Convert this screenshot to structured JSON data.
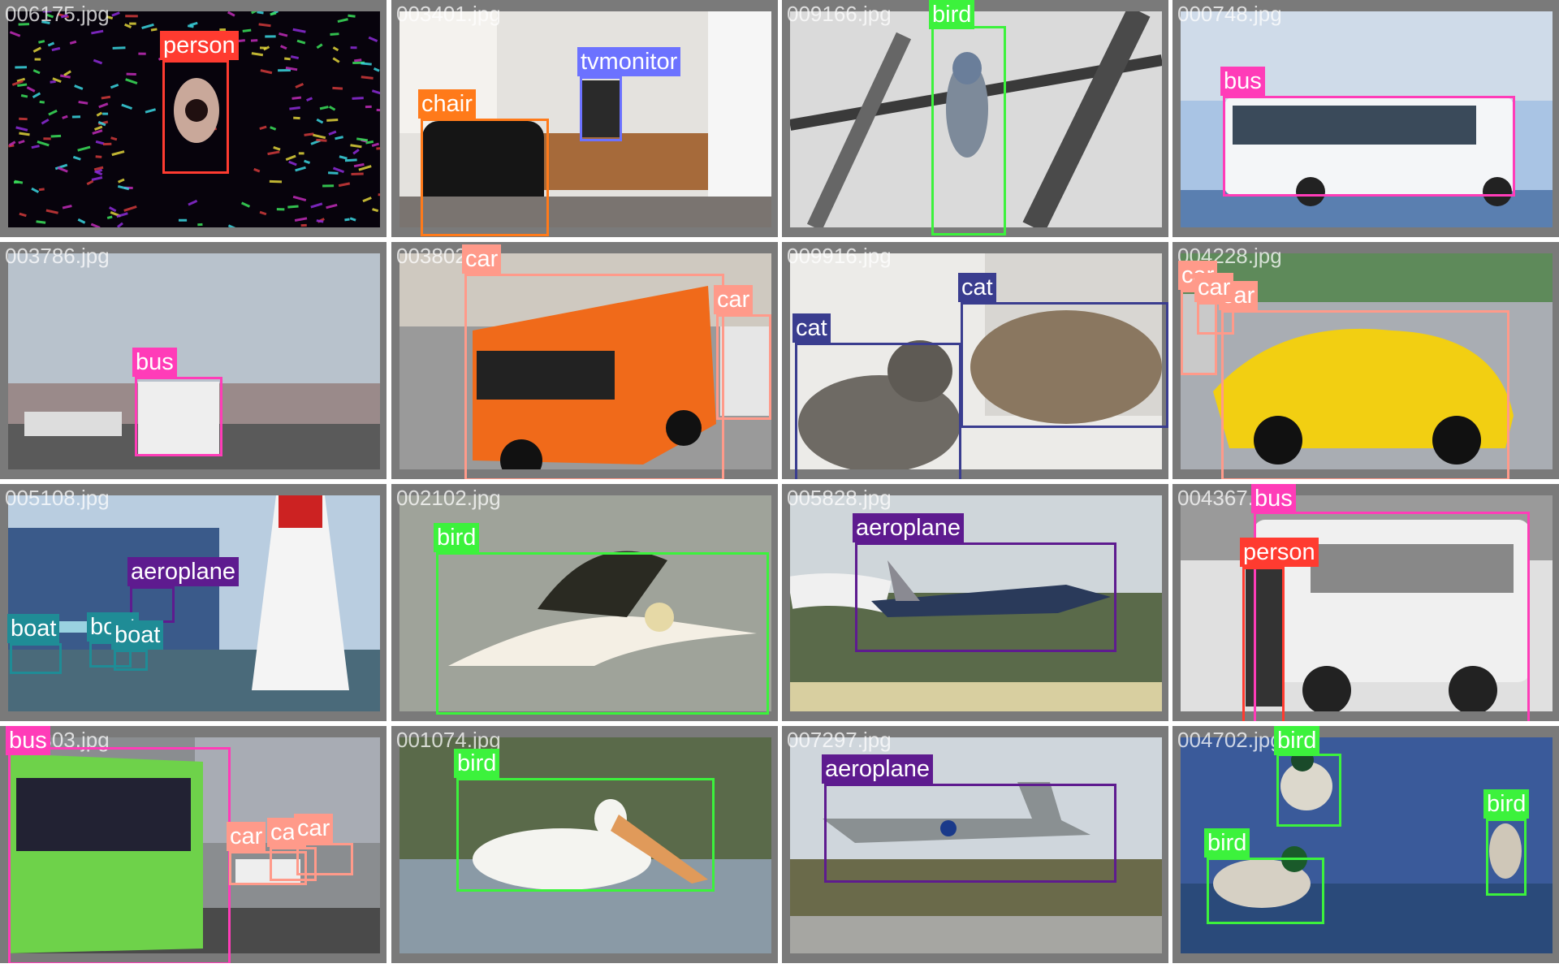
{
  "class_colors": {
    "person": "#ff3b30",
    "chair": "#ff7a1a",
    "tvmonitor": "#6c72ff",
    "bird": "#3cf23c",
    "bus": "#ff3cb8",
    "car": "#ff9a8a",
    "cat": "#3a3d8f",
    "aeroplane": "#5e1b8f",
    "boat": "#1f8c96"
  },
  "tiles": [
    {
      "file": "006175.jpg",
      "scene": "dark-sparkles",
      "labels": [
        {
          "text": "person",
          "cls": "person"
        }
      ]
    },
    {
      "file": "003401.jpg",
      "scene": "office-room",
      "labels": [
        {
          "text": "tvmonitor",
          "cls": "tvmonitor"
        },
        {
          "text": "chair",
          "cls": "chair"
        }
      ]
    },
    {
      "file": "009166.jpg",
      "scene": "bird-branch",
      "labels": [
        {
          "text": "bird",
          "cls": "bird"
        }
      ]
    },
    {
      "file": "000748.jpg",
      "scene": "white-bus",
      "labels": [
        {
          "text": "bus",
          "cls": "bus"
        }
      ]
    },
    {
      "file": "003786.jpg",
      "scene": "cloudy-road",
      "labels": [
        {
          "text": "bus",
          "cls": "bus"
        }
      ]
    },
    {
      "file": "003802.jpg",
      "scene": "orange-van",
      "labels": [
        {
          "text": "car",
          "cls": "car"
        },
        {
          "text": "car",
          "cls": "car"
        }
      ]
    },
    {
      "file": "009916.jpg",
      "scene": "two-cats",
      "labels": [
        {
          "text": "cat",
          "cls": "cat"
        },
        {
          "text": "cat",
          "cls": "cat"
        }
      ]
    },
    {
      "file": "004228.jpg",
      "scene": "yellow-car",
      "labels": [
        {
          "text": "car",
          "cls": "car"
        },
        {
          "text": "car",
          "cls": "car"
        },
        {
          "text": "car",
          "cls": "car"
        }
      ]
    },
    {
      "file": "005108.jpg",
      "scene": "harbor-plane",
      "labels": [
        {
          "text": "aeroplane",
          "cls": "aeroplane"
        },
        {
          "text": "boat",
          "cls": "boat"
        },
        {
          "text": "boat",
          "cls": "boat"
        },
        {
          "text": "boat",
          "cls": "boat"
        }
      ]
    },
    {
      "file": "002102.jpg",
      "scene": "gannet",
      "labels": [
        {
          "text": "bird",
          "cls": "bird"
        }
      ]
    },
    {
      "file": "005828.jpg",
      "scene": "jet-smoke",
      "labels": [
        {
          "text": "aeroplane",
          "cls": "aeroplane"
        }
      ]
    },
    {
      "file": "004367.jpg",
      "scene": "vintage-bus",
      "labels": [
        {
          "text": "bus",
          "cls": "bus"
        },
        {
          "text": "person",
          "cls": "person"
        }
      ]
    },
    {
      "file": "006303.jpg",
      "scene": "green-bus",
      "labels": [
        {
          "text": "bus",
          "cls": "bus"
        },
        {
          "text": "car",
          "cls": "car"
        },
        {
          "text": "car",
          "cls": "car"
        },
        {
          "text": "car",
          "cls": "car"
        },
        {
          "text": "car",
          "cls": "car"
        }
      ]
    },
    {
      "file": "001074.jpg",
      "scene": "pelican",
      "labels": [
        {
          "text": "bird",
          "cls": "bird"
        }
      ]
    },
    {
      "file": "007297.jpg",
      "scene": "prop-plane",
      "labels": [
        {
          "text": "aeroplane",
          "cls": "aeroplane"
        }
      ]
    },
    {
      "file": "004702.jpg",
      "scene": "ducks",
      "labels": [
        {
          "text": "bird",
          "cls": "bird"
        },
        {
          "text": "bird",
          "cls": "bird"
        },
        {
          "text": "bird",
          "cls": "bird"
        }
      ]
    }
  ]
}
